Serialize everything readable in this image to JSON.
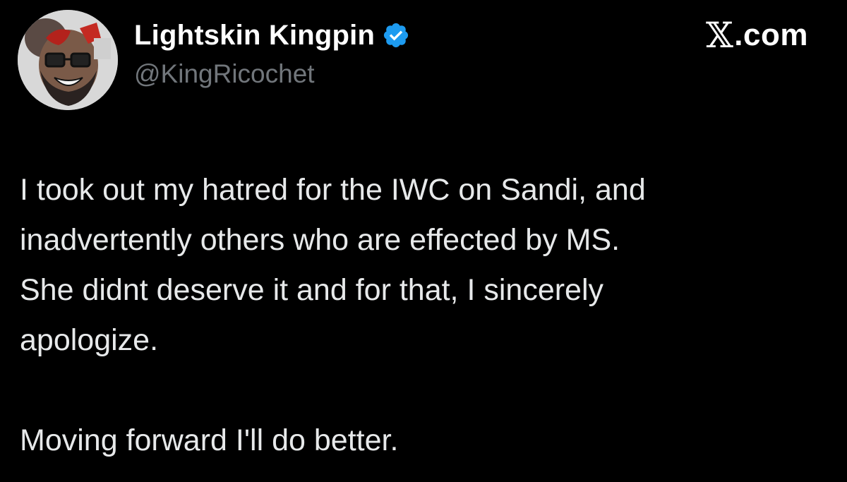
{
  "author": {
    "display_name": "Lightskin Kingpin",
    "handle": "@KingRicochet",
    "verified": true,
    "avatar_icon": "cartoon-face-avatar-icon"
  },
  "brand": {
    "x_glyph": "𝕏",
    "domain_suffix": ".com"
  },
  "tweet": {
    "paragraph_1": [
      "I took out my hatred for the IWC on Sandi, and",
      "inadvertently others who are effected by MS.",
      "She didnt deserve it and for that, I sincerely",
      "apologize."
    ],
    "paragraph_2": "Moving forward I'll do better."
  },
  "colors": {
    "background": "#000000",
    "text_primary": "#e7e9ea",
    "text_secondary": "#71767b",
    "verified_badge": "#1d9bf0"
  }
}
